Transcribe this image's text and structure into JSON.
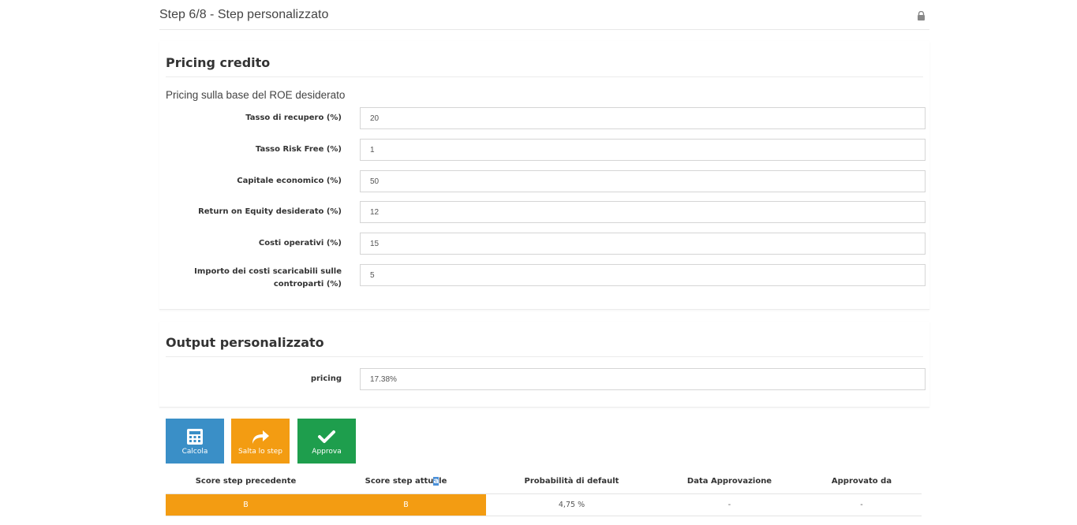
{
  "header": {
    "step_title": "Step 6/8 - Step personalizzato",
    "lock_icon": "lock-icon"
  },
  "pricing_credito": {
    "title": "Pricing credito",
    "subtitle": "Pricing sulla base del ROE desiderato",
    "fields": [
      {
        "label": "Tasso di recupero (%)",
        "value": "20"
      },
      {
        "label": "Tasso Risk Free (%)",
        "value": "1"
      },
      {
        "label": "Capitale economico (%)",
        "value": "50"
      },
      {
        "label": "Return on Equity desiderato (%)",
        "value": "12"
      },
      {
        "label": "Costi operativi (%)",
        "value": "15"
      },
      {
        "label": "Importo dei costi scaricabili sulle controparti (%)",
        "value": "5"
      }
    ]
  },
  "output_personalizzato": {
    "title": "Output personalizzato",
    "pricing_label": "pricing",
    "pricing_value": "17.38%"
  },
  "actions": {
    "calcola": {
      "label": "Calcola",
      "icon": "calculator-icon",
      "color": "#3a8fc7"
    },
    "salta": {
      "label": "Salta lo step",
      "icon": "share-arrow-icon",
      "color": "#f39c12"
    },
    "approva": {
      "label": "Approva",
      "icon": "checkmark-icon",
      "color": "#1e9e4d"
    }
  },
  "summary_table": {
    "headers": {
      "score_prev": "Score step precedente",
      "score_curr_a": "Score step attu",
      "score_curr_b": "a",
      "score_curr_c": "le",
      "pd": "Probabilità di default",
      "date": "Data Approvazione",
      "approver": "Approvato da"
    },
    "row": {
      "score_prev": "B",
      "score_curr": "B",
      "pd": "4,75 %",
      "date": "-",
      "approver": "-"
    },
    "score_color": "#f39c12"
  }
}
